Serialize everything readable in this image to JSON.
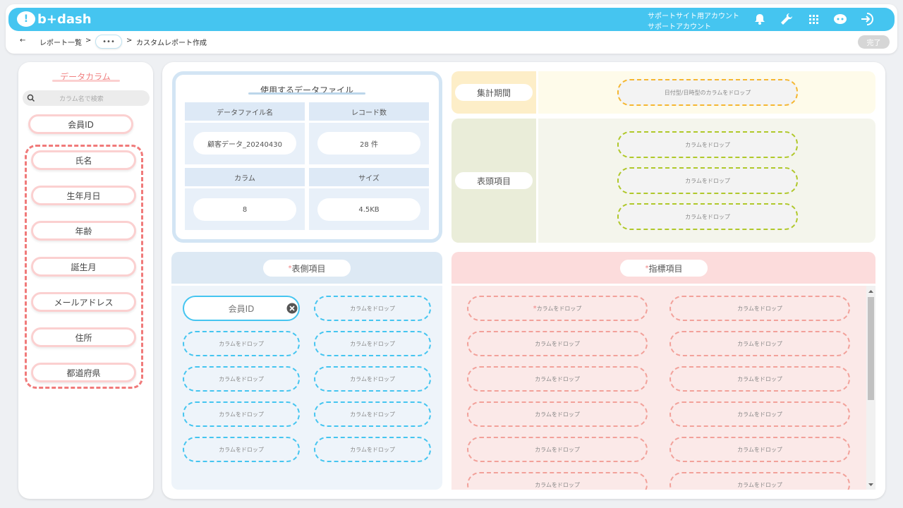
{
  "header": {
    "logo_text": "b+dash",
    "account_line1": "サポートサイト用アカウント",
    "account_line2": "サポートアカウント",
    "icons": [
      "bell-icon",
      "wrench-icon",
      "grid-icon",
      "support-face-icon",
      "logout-icon"
    ]
  },
  "breadcrumb": {
    "back": "←",
    "item1": "レポート一覧",
    "sep": ">",
    "more": "•••",
    "item2": "カスタムレポート作成",
    "done": "完了"
  },
  "left": {
    "title": "データカラム",
    "search_placeholder": "カラム名で検索",
    "items": [
      "会員ID",
      "氏名",
      "生年月日",
      "年齢",
      "誕生月",
      "メールアドレス",
      "住所",
      "都道府県"
    ]
  },
  "file": {
    "title": "使用するデータファイル",
    "h_name": "データファイル名",
    "h_records": "レコード数",
    "v_name": "顧客データ_20240430",
    "v_records": "28 件",
    "h_columns": "カラム",
    "h_size": "サイズ",
    "v_columns": "8",
    "v_size": "4.5KB"
  },
  "period": {
    "label": "集計期間",
    "drop": "日付型/日時型のカラムをドロップ"
  },
  "head_items": {
    "label": "表頭項目",
    "drop": "カラムをドロップ"
  },
  "side_items": {
    "label": "表側項目",
    "star": "*",
    "filled": "会員ID",
    "drop": "カラムをドロップ"
  },
  "metrics": {
    "label": "指標項目",
    "star": "*",
    "drop": "カラムをドロップ",
    "first_star": "*"
  },
  "colors": {
    "accent": "#45c5f0",
    "pink": "#f08080",
    "green": "#b0c82a",
    "orange": "#f5b731"
  }
}
